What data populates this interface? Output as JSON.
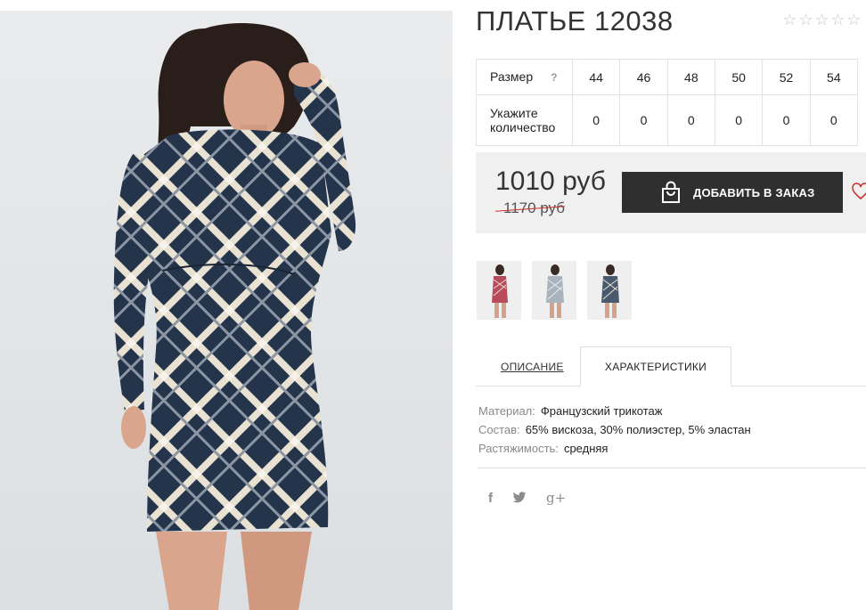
{
  "product": {
    "title": "ПЛАТЬЕ 12038",
    "rating_stars": [
      "☆",
      "☆",
      "☆",
      "☆",
      "☆"
    ]
  },
  "size_table": {
    "size_label": "Размер",
    "help_icon": "?",
    "qty_label": "Укажите количество",
    "sizes": [
      "44",
      "46",
      "48",
      "50",
      "52",
      "54"
    ],
    "quantities": [
      "0",
      "0",
      "0",
      "0",
      "0",
      "0"
    ]
  },
  "price": {
    "current": "1010 руб",
    "old": "1170 руб"
  },
  "order_button": {
    "label": "ДОБАВИТЬ В ЗАКАЗ",
    "icon": "shopping-bag-icon"
  },
  "wishlist": {
    "icon": "heart-icon"
  },
  "thumbnails": [
    {
      "name": "thumbnail-red-plaid",
      "color": "#b84a5a"
    },
    {
      "name": "thumbnail-grey-plaid",
      "color": "#8e9aa6"
    },
    {
      "name": "thumbnail-navy-plaid",
      "color": "#3a4a5e"
    }
  ],
  "tabs": {
    "description": "ОПИСАНИЕ",
    "characteristics": "ХАРАКТЕРИСТИКИ"
  },
  "specs": [
    {
      "key": "Материал:",
      "value": "Французский трикотаж"
    },
    {
      "key": "Состав:",
      "value": "65% вискоза, 30% полиэстер, 5% эластан"
    },
    {
      "key": "Растяжимость:",
      "value": "средняя"
    }
  ],
  "social": {
    "facebook": "f",
    "twitter": "🐦",
    "google_plus": "g+"
  },
  "colors": {
    "button_bg": "#2f2f2f",
    "price_box_bg": "#f0f0f0",
    "old_price_strike": "#c4302b",
    "heart": "#c4302b",
    "dress_navy": "#24344a",
    "dress_cream": "#e9e2d2"
  }
}
